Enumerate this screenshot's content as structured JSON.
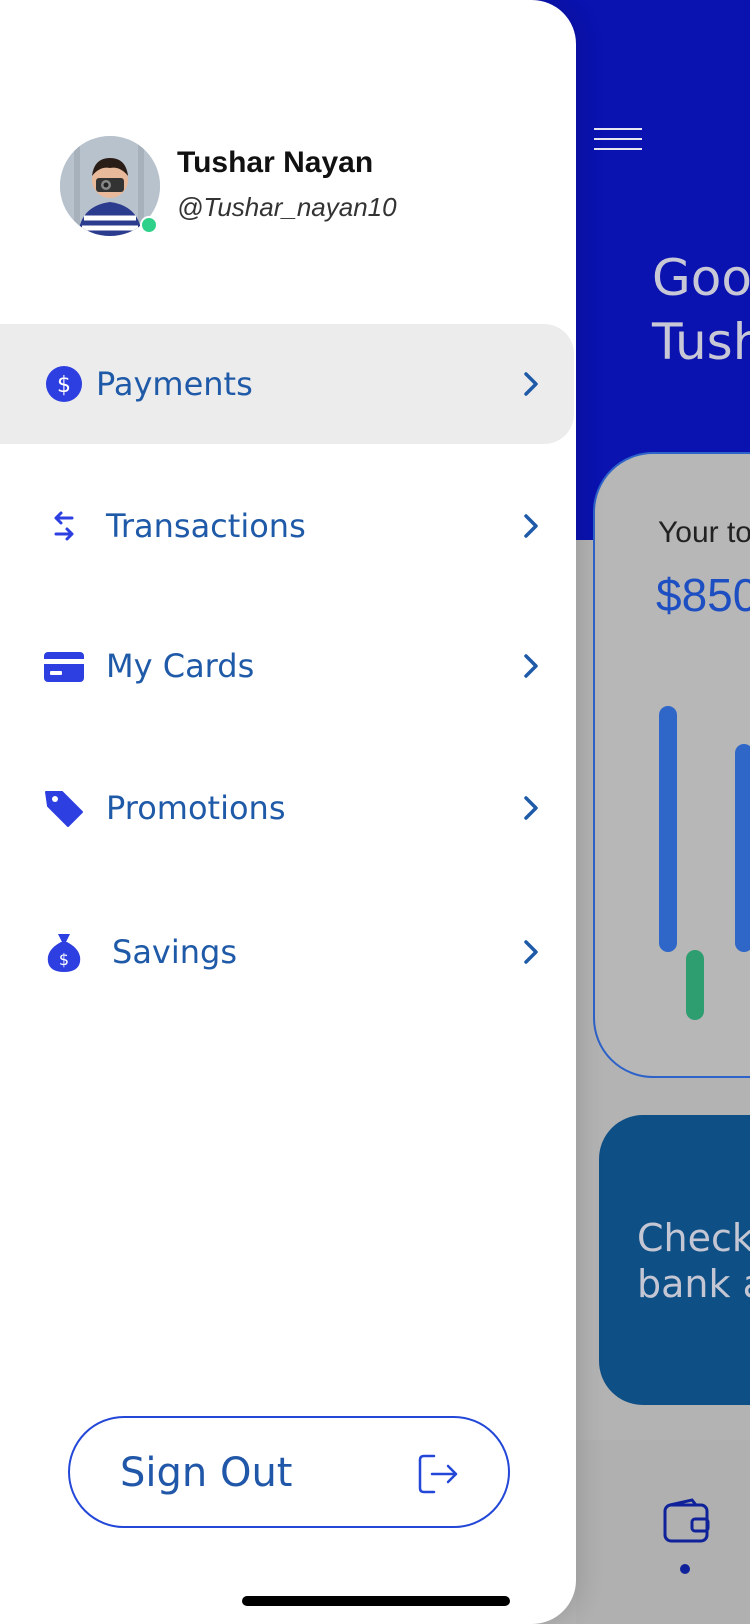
{
  "background_screen": {
    "greeting_line1": "Goo",
    "greeting_line2": "Tush",
    "balance_label": "Your to",
    "balance_value": "$850",
    "promo_line1": "Check",
    "promo_line2": "bank a",
    "colors": {
      "header": "#0a12b0",
      "bar_primary": "#2e67c8",
      "bar_secondary": "#2e9d70"
    }
  },
  "drawer": {
    "profile": {
      "name": "Tushar Nayan",
      "handle": "@Tushar_nayan10",
      "status": "online"
    },
    "menu": [
      {
        "label": "Payments",
        "icon": "dollar-circle-icon",
        "active": true
      },
      {
        "label": "Transactions",
        "icon": "swap-arrows-icon",
        "active": false
      },
      {
        "label": "My Cards",
        "icon": "credit-card-icon",
        "active": false
      },
      {
        "label": "Promotions",
        "icon": "tag-icon",
        "active": false
      },
      {
        "label": "Savings",
        "icon": "money-bag-icon",
        "active": false
      }
    ],
    "signout": {
      "label": "Sign Out",
      "icon": "logout-icon"
    }
  },
  "colors": {
    "accent": "#2348d8",
    "label_blue": "#1f5aa8",
    "active_bg": "#ececec",
    "online": "#2fd18a"
  }
}
